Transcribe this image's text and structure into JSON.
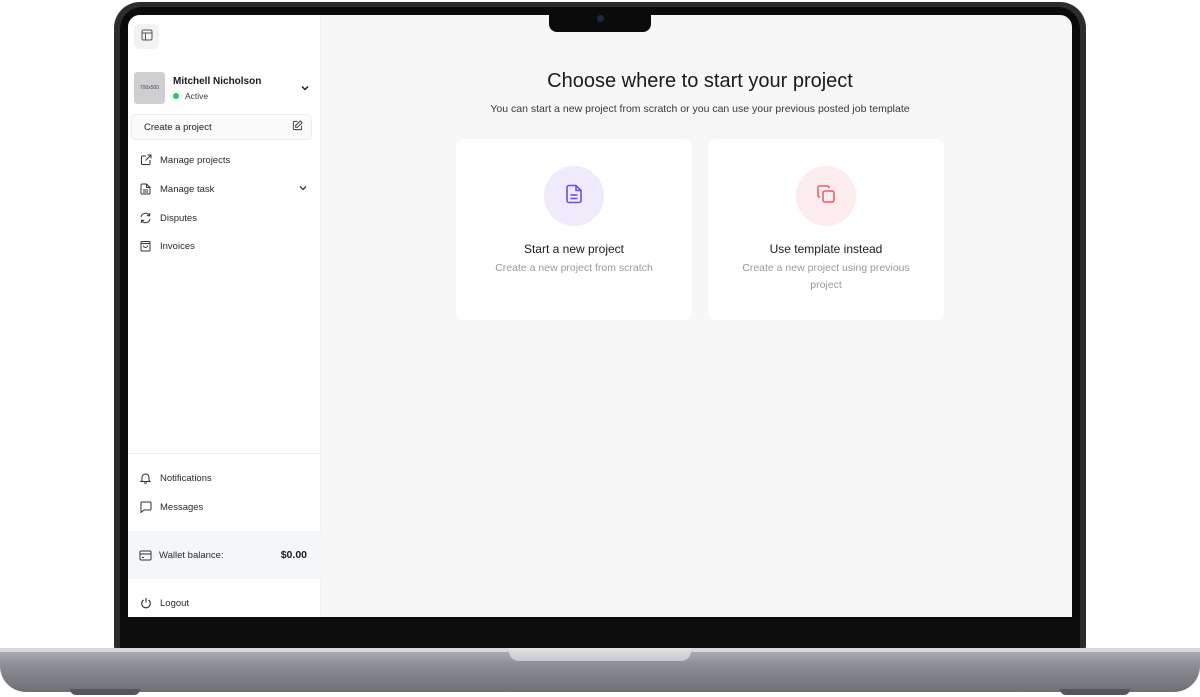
{
  "sidebar": {
    "collapse_icon": "layout-sidebar-icon",
    "profile": {
      "avatar_text": "700x500",
      "name": "Mitchell Nicholson",
      "status": "Active",
      "status_color": "#22c55e"
    },
    "create_project_label": "Create a project",
    "nav_items": [
      {
        "label": "Manage projects",
        "icon": "external-link-icon"
      },
      {
        "label": "Manage task",
        "icon": "document-icon"
      },
      {
        "label": "Disputes",
        "icon": "refresh-icon"
      },
      {
        "label": "Invoices",
        "icon": "shopping-bag-icon"
      }
    ],
    "bottom_items": [
      {
        "label": "Notifications",
        "icon": "bell-icon"
      },
      {
        "label": "Messages",
        "icon": "message-icon"
      }
    ],
    "wallet": {
      "label": "Wallet balance:",
      "amount": "$0.00"
    },
    "logout_label": "Logout"
  },
  "main": {
    "heading": "Choose where to start your project",
    "subheading": "You can start a new project from scratch or you can use your previous posted job template",
    "cards": [
      {
        "title": "Start a new project",
        "description": "Create a new project from scratch",
        "icon": "document-icon",
        "icon_color": "#6d4ee0",
        "icon_bg": "#efebfd"
      },
      {
        "title": "Use template instead",
        "description": "Create a new project using previous project",
        "icon": "copy-icon",
        "icon_color": "#ef5d6c",
        "icon_bg": "#fdecee"
      }
    ],
    "chat_button_icon": "chat-assistant-icon",
    "chat_button_color": "#f97316"
  }
}
